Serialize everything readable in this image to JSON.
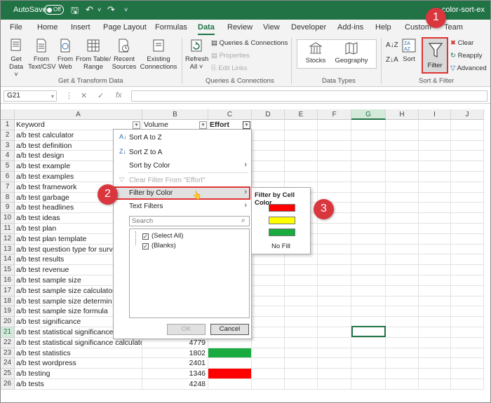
{
  "titlebar": {
    "autosave_label": "AutoSave",
    "toggle_state": "Off",
    "filename": "color-sort-ex"
  },
  "menu_tabs": [
    "File",
    "Home",
    "Insert",
    "Page Layout",
    "Formulas",
    "Data",
    "Review",
    "View",
    "Developer",
    "Add-ins",
    "Help",
    "Custom",
    "Team"
  ],
  "ribbon": {
    "get_data": [
      "Get",
      "Data ˅"
    ],
    "from_text": [
      "From",
      "Text/CSV"
    ],
    "from_web": [
      "From",
      "Web"
    ],
    "from_table": [
      "From Table/",
      "Range"
    ],
    "recent_sources": [
      "Recent",
      "Sources"
    ],
    "existing": [
      "Existing",
      "Connections"
    ],
    "group_transform": "Get & Transform Data",
    "refresh": [
      "Refresh",
      "All ˅"
    ],
    "queries_connections": "Queries & Connections",
    "properties": "Properties",
    "edit_links": "Edit Links",
    "group_queries": "Queries & Connections",
    "stocks": "Stocks",
    "geography": "Geography",
    "group_datatypes": "Data Types",
    "sort": "Sort",
    "filter": "Filter",
    "clear": "Clear",
    "reapply": "Reapply",
    "advanced": "Advanced",
    "group_sortfilter": "Sort & Filter"
  },
  "formula": {
    "namebox": "G21",
    "fx": "fx"
  },
  "columns": [
    "A",
    "B",
    "C",
    "D",
    "E",
    "F",
    "G",
    "H",
    "I",
    "J"
  ],
  "sheet": {
    "headers": [
      "Keyword",
      "Volume",
      "Effort"
    ],
    "rows": [
      [
        "a/b test calculator",
        ""
      ],
      [
        "a/b test definition",
        ""
      ],
      [
        "a/b test design",
        ""
      ],
      [
        "a/b test example",
        ""
      ],
      [
        "a/b test examples",
        ""
      ],
      [
        "a/b test framework",
        ""
      ],
      [
        "a/b test garbage",
        ""
      ],
      [
        "a/b test headlines",
        ""
      ],
      [
        "a/b test ideas",
        ""
      ],
      [
        "a/b test plan",
        ""
      ],
      [
        "a/b test plan template",
        ""
      ],
      [
        "a/b test question type for surv",
        ""
      ],
      [
        "a/b test results",
        ""
      ],
      [
        "a/b test revenue",
        ""
      ],
      [
        "a/b test sample size",
        ""
      ],
      [
        "a/b test sample size calculator",
        ""
      ],
      [
        "a/b test sample size determin",
        ""
      ],
      [
        "a/b test sample size formula",
        ""
      ],
      [
        "a/b test significance",
        ""
      ],
      [
        "a/b test statistical significance",
        ""
      ],
      [
        "a/b test statistical significance calculato",
        "4779"
      ],
      [
        "a/b test statistics",
        "1802"
      ],
      [
        "a/b test wordpress",
        "2401"
      ],
      [
        "a/b testing",
        "1346"
      ],
      [
        "a/b tests",
        "4248"
      ]
    ],
    "effort_colors": {
      "23": "#1aab40",
      "25": "#ff0000"
    }
  },
  "dropdown": {
    "sort_az": "Sort A to Z",
    "sort_za": "Sort Z to A",
    "sort_by_color": "Sort by Color",
    "clear_filter": "Clear Filter From \"Effort\"",
    "filter_by_color": "Filter by Color",
    "text_filters": "Text Filters",
    "search_placeholder": "Search",
    "select_all": "(Select All)",
    "blanks": "(Blanks)",
    "ok": "OK",
    "cancel": "Cancel"
  },
  "submenu": {
    "title": "Filter by Cell Color",
    "colors": [
      "#ff0000",
      "#ffff00",
      "#1aab40"
    ],
    "no_fill": "No Fill"
  },
  "badges": [
    "1",
    "2",
    "3"
  ]
}
